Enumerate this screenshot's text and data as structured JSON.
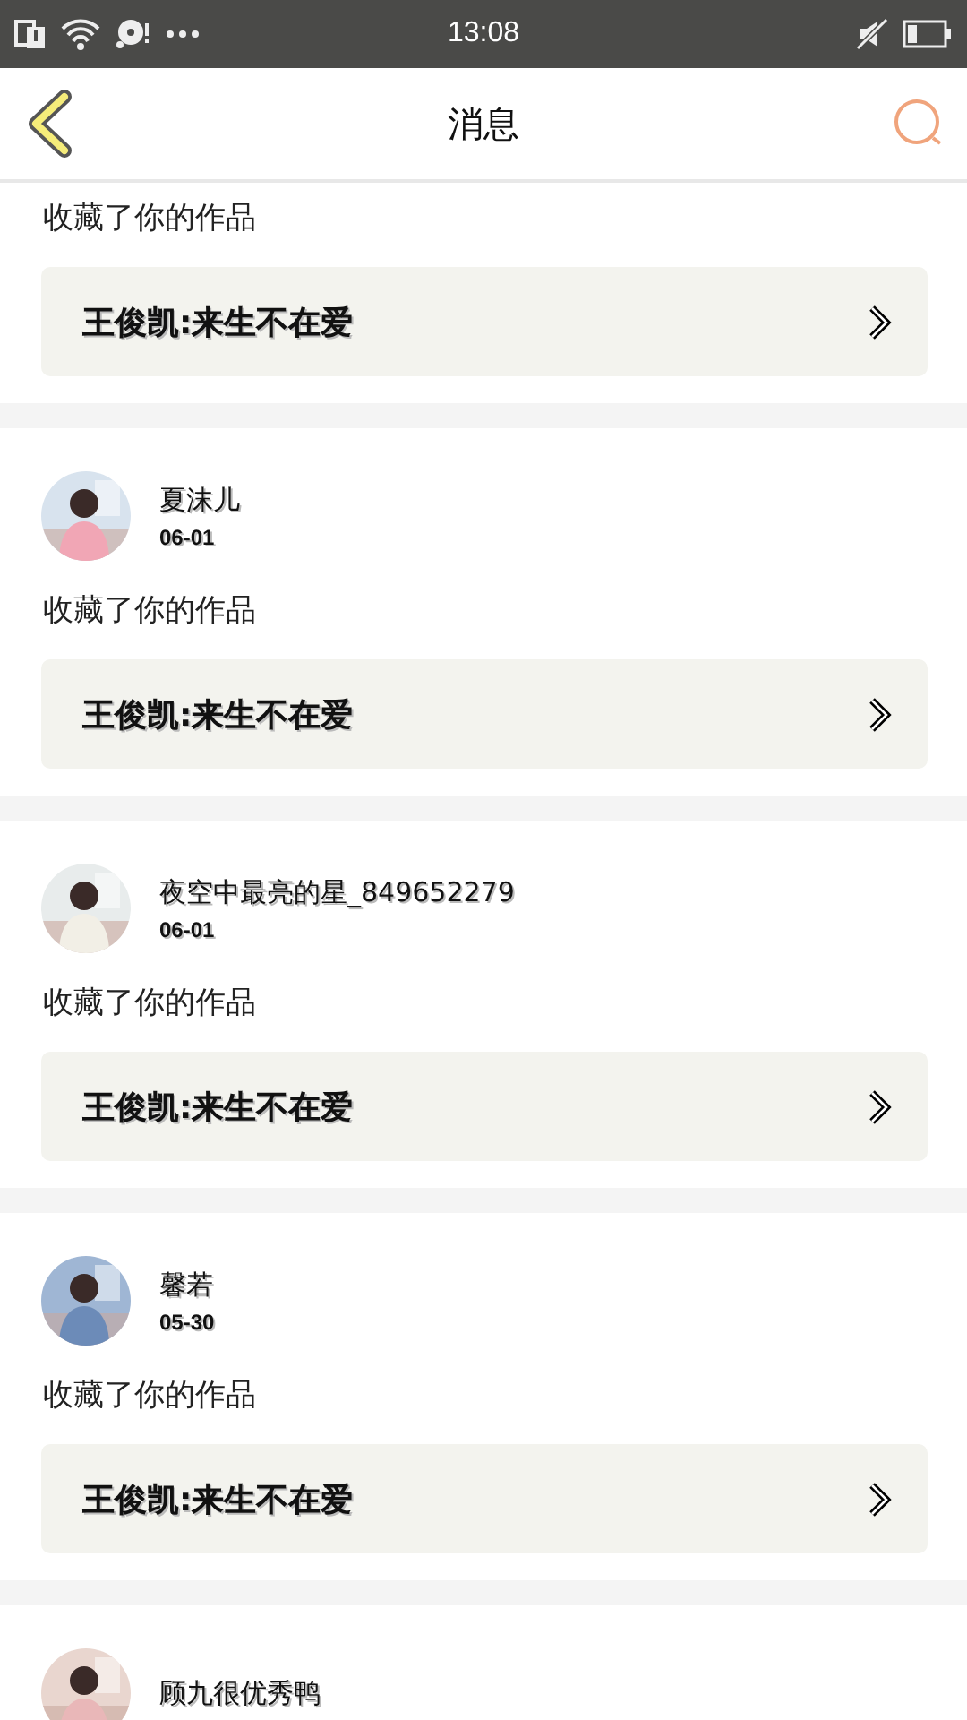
{
  "status_bar": {
    "time": "13:08"
  },
  "header": {
    "title": "消息"
  },
  "messages": [
    {
      "action": "收藏了你的作品",
      "work": "王俊凯:来生不在爱"
    },
    {
      "user": "夏沫儿",
      "date": "06-01",
      "action": "收藏了你的作品",
      "work": "王俊凯:来生不在爱"
    },
    {
      "user": "夜空中最亮的星_849652279",
      "date": "06-01",
      "action": "收藏了你的作品",
      "work": "王俊凯:来生不在爱"
    },
    {
      "user": "馨若",
      "date": "05-30",
      "action": "收藏了你的作品",
      "work": "王俊凯:来生不在爱"
    },
    {
      "user": "顾九很优秀鸭"
    }
  ]
}
